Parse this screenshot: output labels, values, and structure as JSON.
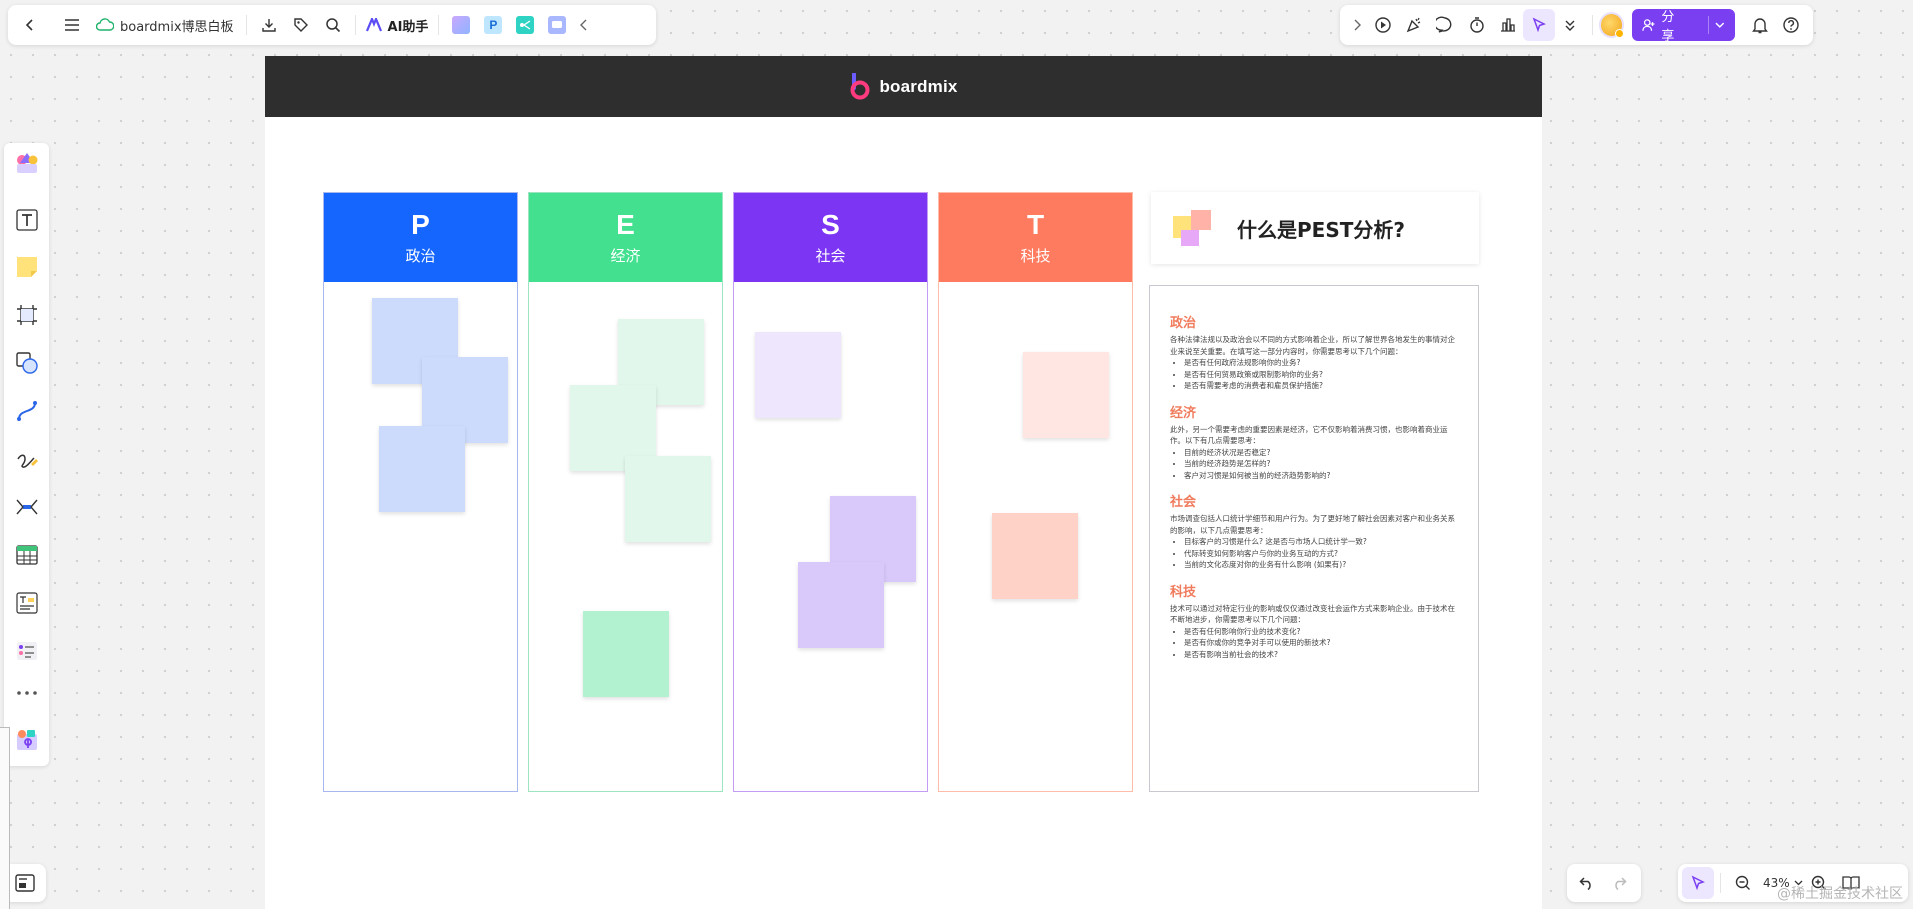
{
  "topbar": {
    "doc_title": "boardmix博思白板",
    "ai_label": "AI助手"
  },
  "rightbar": {
    "share_label": "分享"
  },
  "board": {
    "brand": "boardmix",
    "columns": [
      {
        "letter": "P",
        "name": "政治",
        "color": "#1466ff",
        "border": "#a9b7ef"
      },
      {
        "letter": "E",
        "name": "经济",
        "color": "#42e08f",
        "border": "#9be6c0"
      },
      {
        "letter": "S",
        "name": "社会",
        "color": "#7d35f4",
        "border": "#c29cf5"
      },
      {
        "letter": "T",
        "name": "科技",
        "color": "#ff7b5f",
        "border": "#ffbca9"
      }
    ],
    "question_title": "什么是PEST分析?",
    "sections": [
      {
        "title": "政治",
        "text": "各种法律法规以及政治会以不同的方式影响着企业，所以了解世界各地发生的事情对企业来说至关重要。在填写这一部分内容时，你需要思考以下几个问题：",
        "items": [
          "是否有任何政府法规影响你的业务?",
          "是否有任何贸易政策或限制影响你的业务?",
          "是否有需要考虑的消费者和雇员保护措施?"
        ]
      },
      {
        "title": "经济",
        "text": "此外，另一个需要考虑的重要因素是经济，它不仅影响着消费习惯，也影响着商业运作。以下有几点需要思考：",
        "items": [
          "目前的经济状况是否稳定?",
          "当前的经济趋势是怎样的?",
          "客户对习惯是如何被当前的经济趋势影响的?"
        ]
      },
      {
        "title": "社会",
        "text": "市场调查包括人口统计学细节和用户行为。为了更好地了解社会因素对客户和业务关系的影响，以下几点需要思考：",
        "items": [
          "目标客户的习惯是什么? 这是否与市场人口统计学一致?",
          "代际转变如何影响客户与你的业务互动的方式?",
          "当前的文化态度对你的业务有什么影响 (如果有)?"
        ]
      },
      {
        "title": "科技",
        "text": "技术可以通过对特定行业的影响或仅仅通过改变社会运作方式来影响企业。由于技术在不断地进步，你需要思考以下几个问题：",
        "items": [
          "是否有任何影响你行业的技术变化?",
          "是否有你或你的竞争对手可以使用的新技术?",
          "是否有影响当前社会的技术?"
        ]
      }
    ]
  },
  "zoom": {
    "value": "43%"
  },
  "watermark": "@稀土掘金技术社区"
}
